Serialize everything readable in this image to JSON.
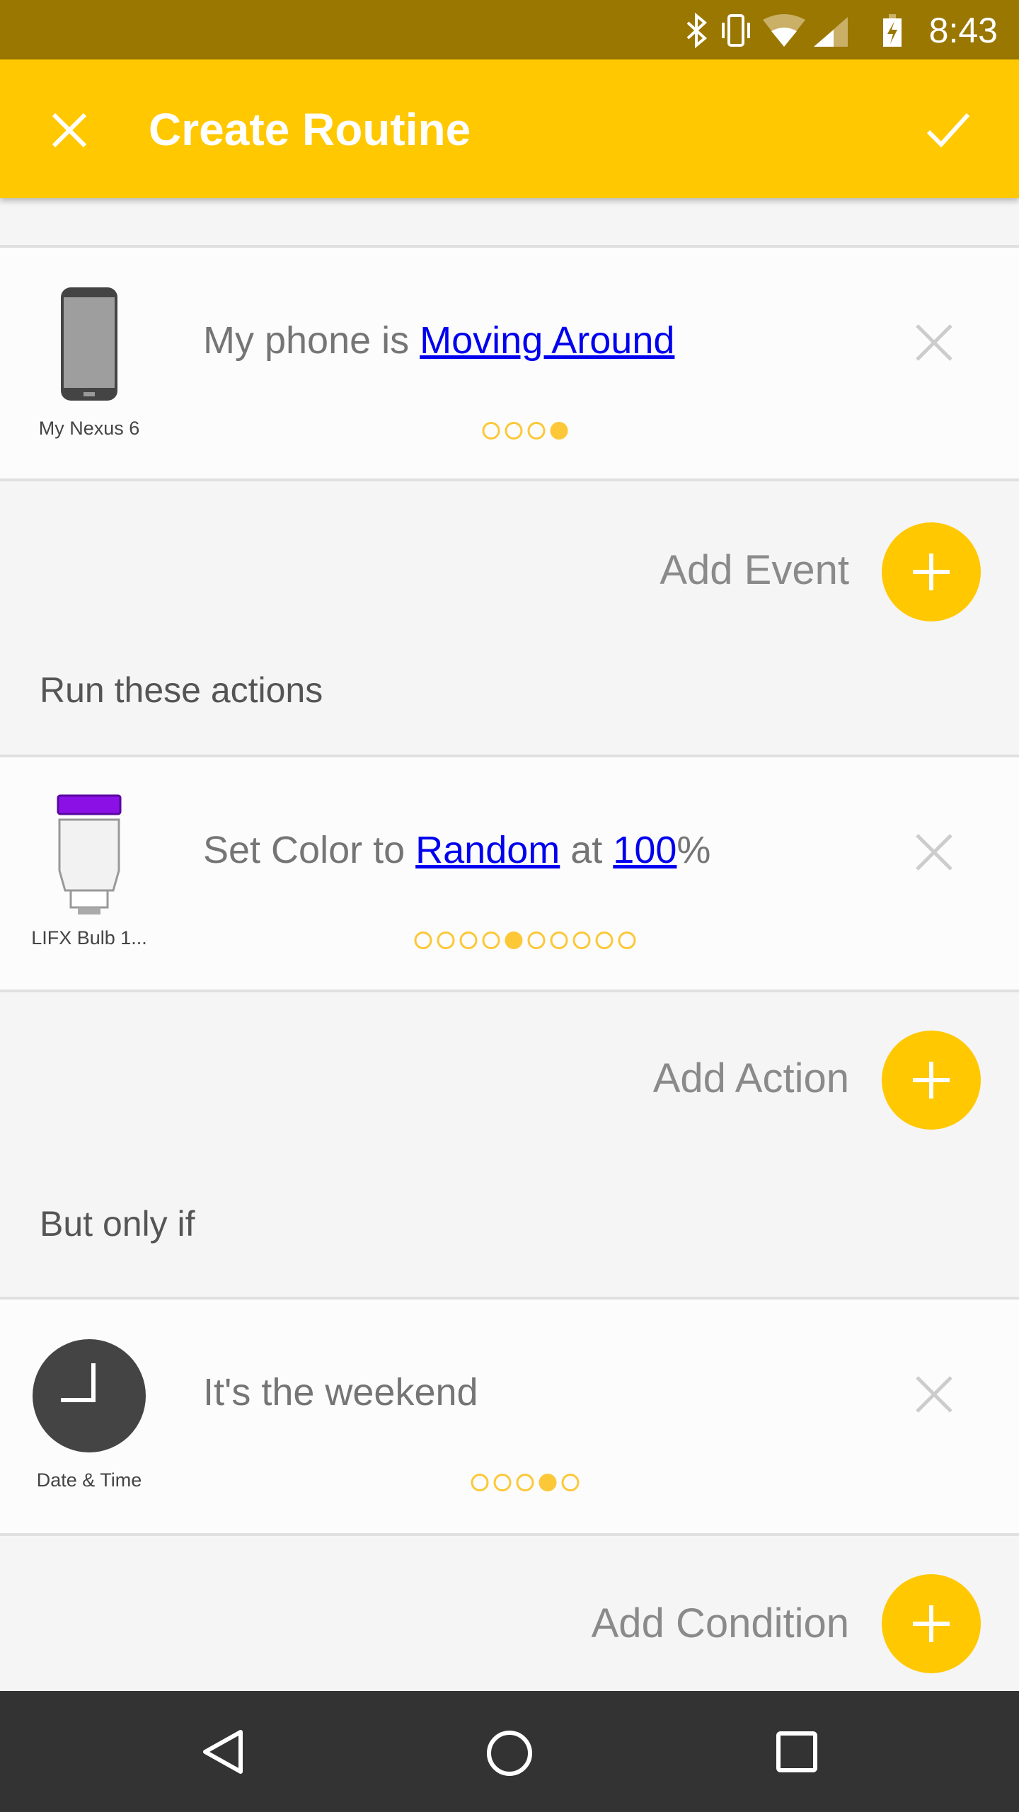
{
  "status_bar": {
    "time": "8:43",
    "icons": [
      "bluetooth-icon",
      "vibrate-icon",
      "wifi-icon",
      "signal-icon",
      "battery-charging-icon"
    ]
  },
  "app_bar": {
    "title": "Create Routine",
    "close_icon": "close-icon",
    "confirm_icon": "check-icon"
  },
  "event": {
    "device_label": "My Nexus 6",
    "text_prefix": "My phone is ",
    "link": "Moving Around",
    "dots_total": 4,
    "dots_active": 3
  },
  "add_event_label": "Add Event",
  "actions_section": "Run these actions",
  "action": {
    "device_label": "LIFX Bulb 1...",
    "text_prefix": "Set Color to ",
    "link1": "Random",
    "mid": " at ",
    "link2": "100",
    "suffix": "%",
    "bulb_color": "#8a10e6",
    "dots_total": 10,
    "dots_active": 4
  },
  "add_action_label": "Add Action",
  "conditions_section": "But only if",
  "condition": {
    "device_label": "Date & Time",
    "text": "It's the weekend",
    "dots_total": 5,
    "dots_active": 3
  },
  "add_condition_label": "Add Condition",
  "colors": {
    "accent": "#ffc800",
    "status_bar": "#997700",
    "link": "#0000ee"
  }
}
